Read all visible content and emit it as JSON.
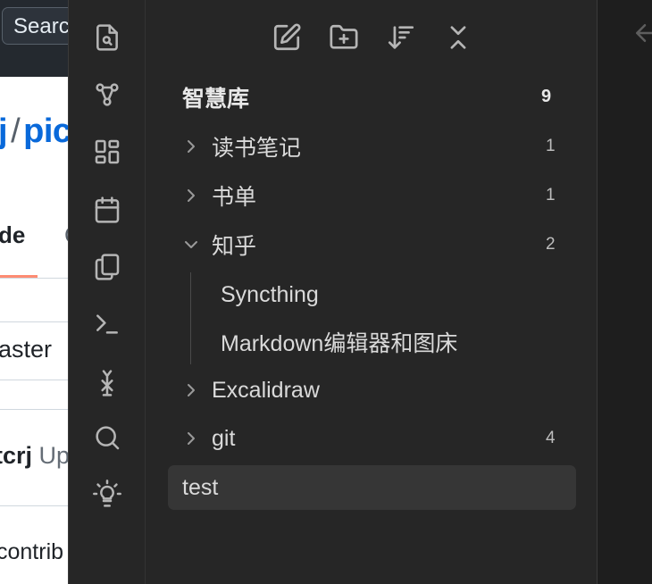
{
  "background_window": {
    "search_text": "Search",
    "repo_owner": "j",
    "repo_separator": "/",
    "repo_name": "pic",
    "tab_label": "de",
    "tab_more": "C",
    "branch": "aster",
    "commit_author": "tcrj",
    "commit_action": "Up",
    "contributors": "contrib"
  },
  "ribbon": {
    "icons": [
      "open-quick-switcher-icon",
      "graph-view-icon",
      "canvas-icon",
      "daily-note-icon",
      "templates-icon",
      "command-palette-icon",
      "excalidraw-icon",
      "search-icon",
      "bulb-icon"
    ]
  },
  "explorer": {
    "toolbar": [
      "new-note-icon",
      "new-folder-icon",
      "sort-icon",
      "collapse-all-icon"
    ],
    "vault": {
      "name": "智慧库",
      "count": "9"
    },
    "items": [
      {
        "label": "读书笔记",
        "count": "1",
        "type": "folder",
        "expanded": false
      },
      {
        "label": "书单",
        "count": "1",
        "type": "folder",
        "expanded": false
      },
      {
        "label": "知乎",
        "count": "2",
        "type": "folder",
        "expanded": true
      },
      {
        "label": "Syncthing",
        "type": "file"
      },
      {
        "label": "Markdown编辑器和图床",
        "type": "file"
      },
      {
        "label": "Excalidraw",
        "type": "folder",
        "expanded": false
      },
      {
        "label": "git",
        "count": "4",
        "type": "folder",
        "expanded": false
      },
      {
        "label": "test",
        "type": "file",
        "selected": true
      }
    ]
  },
  "colors": {
    "explorer_bg": "#262626",
    "selected_bg": "#363636",
    "text": "#dadada"
  }
}
